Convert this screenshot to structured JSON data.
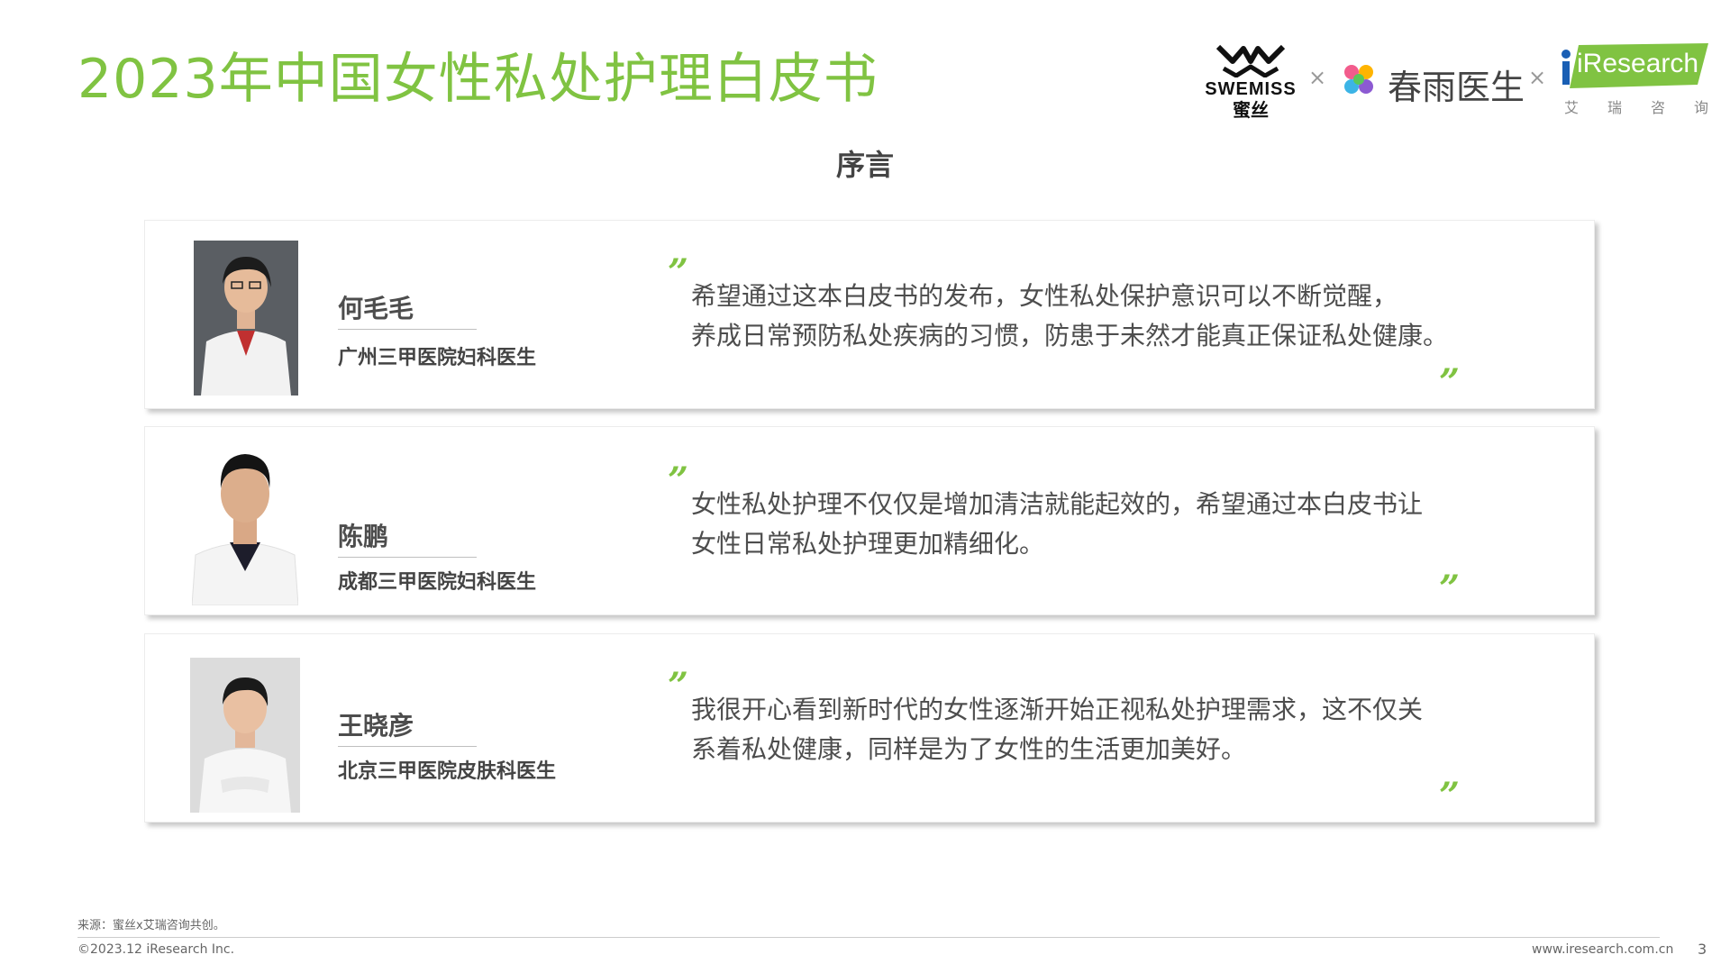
{
  "header": {
    "title": "2023年中国女性私处护理白皮书",
    "logos": {
      "swemiss_latin": "SWEMISS",
      "swemiss_cn": "蜜丝",
      "separator": "×",
      "chunyu_name": "春雨医生",
      "iresearch_name": "iResearch",
      "iresearch_sub": [
        "艾",
        "瑞",
        "咨",
        "询"
      ]
    }
  },
  "section_title": "序言",
  "doctors": [
    {
      "name": "何毛毛",
      "title": "广州三甲医院妇科医生",
      "quote_lines": [
        "希望通过这本白皮书的发布，女性私处保护意识可以不断觉醒，",
        "养成日常预防私处疾病的习惯，防患于未然才能真正保证私处健康。"
      ]
    },
    {
      "name": "陈鹏",
      "title": "成都三甲医院妇科医生",
      "quote_lines": [
        "女性私处护理不仅仅是增加清洁就能起效的，希望通过本白皮书让",
        "女性日常私处护理更加精细化。"
      ]
    },
    {
      "name": "王晓彦",
      "title": "北京三甲医院皮肤科医生",
      "quote_lines": [
        "我很开心看到新时代的女性逐渐开始正视私处护理需求，这不仅关",
        "系着私处健康，同样是为了女性的生活更加美好。"
      ]
    }
  ],
  "quote_open": "”",
  "quote_close": "”",
  "colors": {
    "brand_green": "#80c342",
    "text_dark": "#4d4d4d"
  },
  "footer": {
    "source": "来源：蜜丝x艾瑞咨询共创。",
    "copyright": "©2023.12 iResearch Inc.",
    "website": "www.iresearch.com.cn",
    "page_number": "3"
  }
}
